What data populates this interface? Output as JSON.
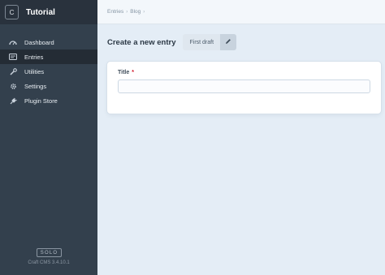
{
  "site": {
    "badge": "C",
    "name": "Tutorial"
  },
  "nav": {
    "items": [
      {
        "label": "Dashboard",
        "icon": "dashboard-icon"
      },
      {
        "label": "Entries",
        "icon": "entries-icon",
        "active": true
      },
      {
        "label": "Utilities",
        "icon": "wrench-icon"
      },
      {
        "label": "Settings",
        "icon": "gear-icon"
      },
      {
        "label": "Plugin Store",
        "icon": "plug-icon"
      }
    ]
  },
  "footer": {
    "edition": "SOLO",
    "version": "Craft CMS 3.4.10.1"
  },
  "breadcrumb": {
    "items": [
      "Entries",
      "Blog"
    ]
  },
  "page": {
    "title": "Create a new entry",
    "draft_label": "First draft"
  },
  "form": {
    "title_label": "Title",
    "required_mark": "*",
    "title_value": "",
    "title_placeholder": ""
  },
  "colors": {
    "sidebar": "#33404d",
    "sidebar_header": "#29323d",
    "active_nav": "#242c35",
    "content_bg": "#e4edf6",
    "required": "#cf1124"
  }
}
